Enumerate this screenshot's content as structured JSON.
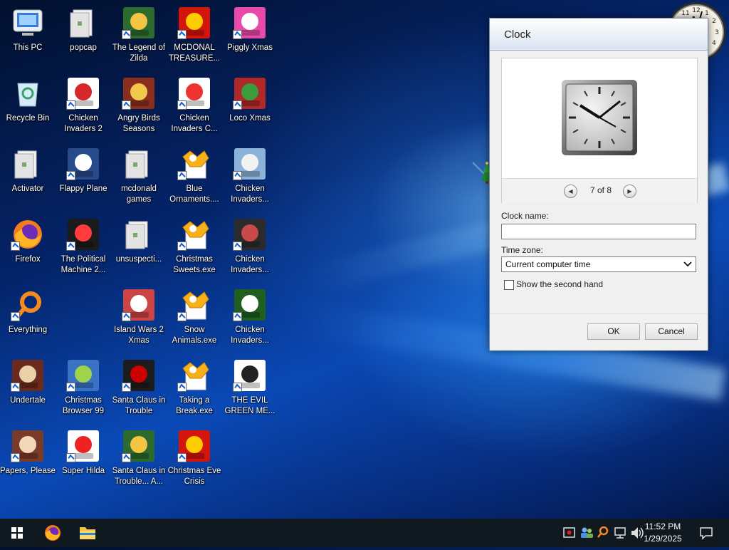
{
  "desktop": {
    "icons": [
      {
        "label": "This PC",
        "icon": "computer-icon"
      },
      {
        "label": "popcap",
        "icon": "folder-icon"
      },
      {
        "label": "The Legend of Zilda",
        "icon": "game-icon"
      },
      {
        "label": "MCDONAL TREASURE...",
        "icon": "game-icon"
      },
      {
        "label": "Piggly Xmas",
        "icon": "game-icon"
      },
      {
        "label": "Recycle Bin",
        "icon": "recycle-bin-icon"
      },
      {
        "label": "Chicken Invaders 2",
        "icon": "game-icon"
      },
      {
        "label": "Angry Birds Seasons",
        "icon": "game-icon"
      },
      {
        "label": "Chicken Invaders C...",
        "icon": "game-icon"
      },
      {
        "label": "Loco Xmas",
        "icon": "game-icon"
      },
      {
        "label": "Activator",
        "icon": "folder-icon"
      },
      {
        "label": "Flappy Plane",
        "icon": "game-icon"
      },
      {
        "label": "mcdonald games",
        "icon": "folder-icon"
      },
      {
        "label": "Blue Ornaments....",
        "icon": "exe-icon"
      },
      {
        "label": "Chicken Invaders...",
        "icon": "game-icon"
      },
      {
        "label": "Firefox",
        "icon": "firefox-icon"
      },
      {
        "label": "The Political Machine 2...",
        "icon": "game-icon"
      },
      {
        "label": "unsuspecti...",
        "icon": "folder-icon"
      },
      {
        "label": "Christmas Sweets.exe",
        "icon": "exe-icon"
      },
      {
        "label": "Chicken Invaders...",
        "icon": "game-icon"
      },
      {
        "label": "Everything",
        "icon": "search-icon"
      },
      {
        "label": "Island Wars 2 Xmas",
        "icon": "game-icon"
      },
      {
        "label": "Snow Animals.exe",
        "icon": "exe-icon"
      },
      {
        "label": "Chicken Invaders...",
        "icon": "game-icon"
      },
      {
        "label": "Undertale",
        "icon": "game-icon"
      },
      {
        "label": "Christmas Browser 99",
        "icon": "game-icon"
      },
      {
        "label": "Santa Claus in Trouble",
        "icon": "game-icon"
      },
      {
        "label": "Taking a Break.exe",
        "icon": "exe-icon"
      },
      {
        "label": "THE EVIL GREEN ME...",
        "icon": "game-icon"
      },
      {
        "label": "Papers, Please",
        "icon": "game-icon"
      },
      {
        "label": "Super Hilda",
        "icon": "game-icon"
      },
      {
        "label": "Santa Claus in Trouble... A...",
        "icon": "game-icon"
      },
      {
        "label": "Christmas Eve Crisis",
        "icon": "game-icon"
      }
    ]
  },
  "dialog": {
    "title": "Clock",
    "pager": "7 of 8",
    "clock_name_label": "Clock name:",
    "clock_name_value": "",
    "time_zone_label": "Time zone:",
    "time_zone_value": "Current computer time",
    "show_second_hand_label": "Show the second hand",
    "show_second_hand_checked": false,
    "ok_label": "OK",
    "cancel_label": "Cancel"
  },
  "taskbar": {
    "time": "11:52 PM",
    "date": "1/29/2025",
    "pinned": [
      "start-icon",
      "firefox-icon",
      "file-explorer-icon"
    ],
    "tray": [
      "security-icon",
      "network-users-icon",
      "search-tool-icon",
      "network-icon",
      "volume-icon",
      "notifications-icon"
    ]
  }
}
